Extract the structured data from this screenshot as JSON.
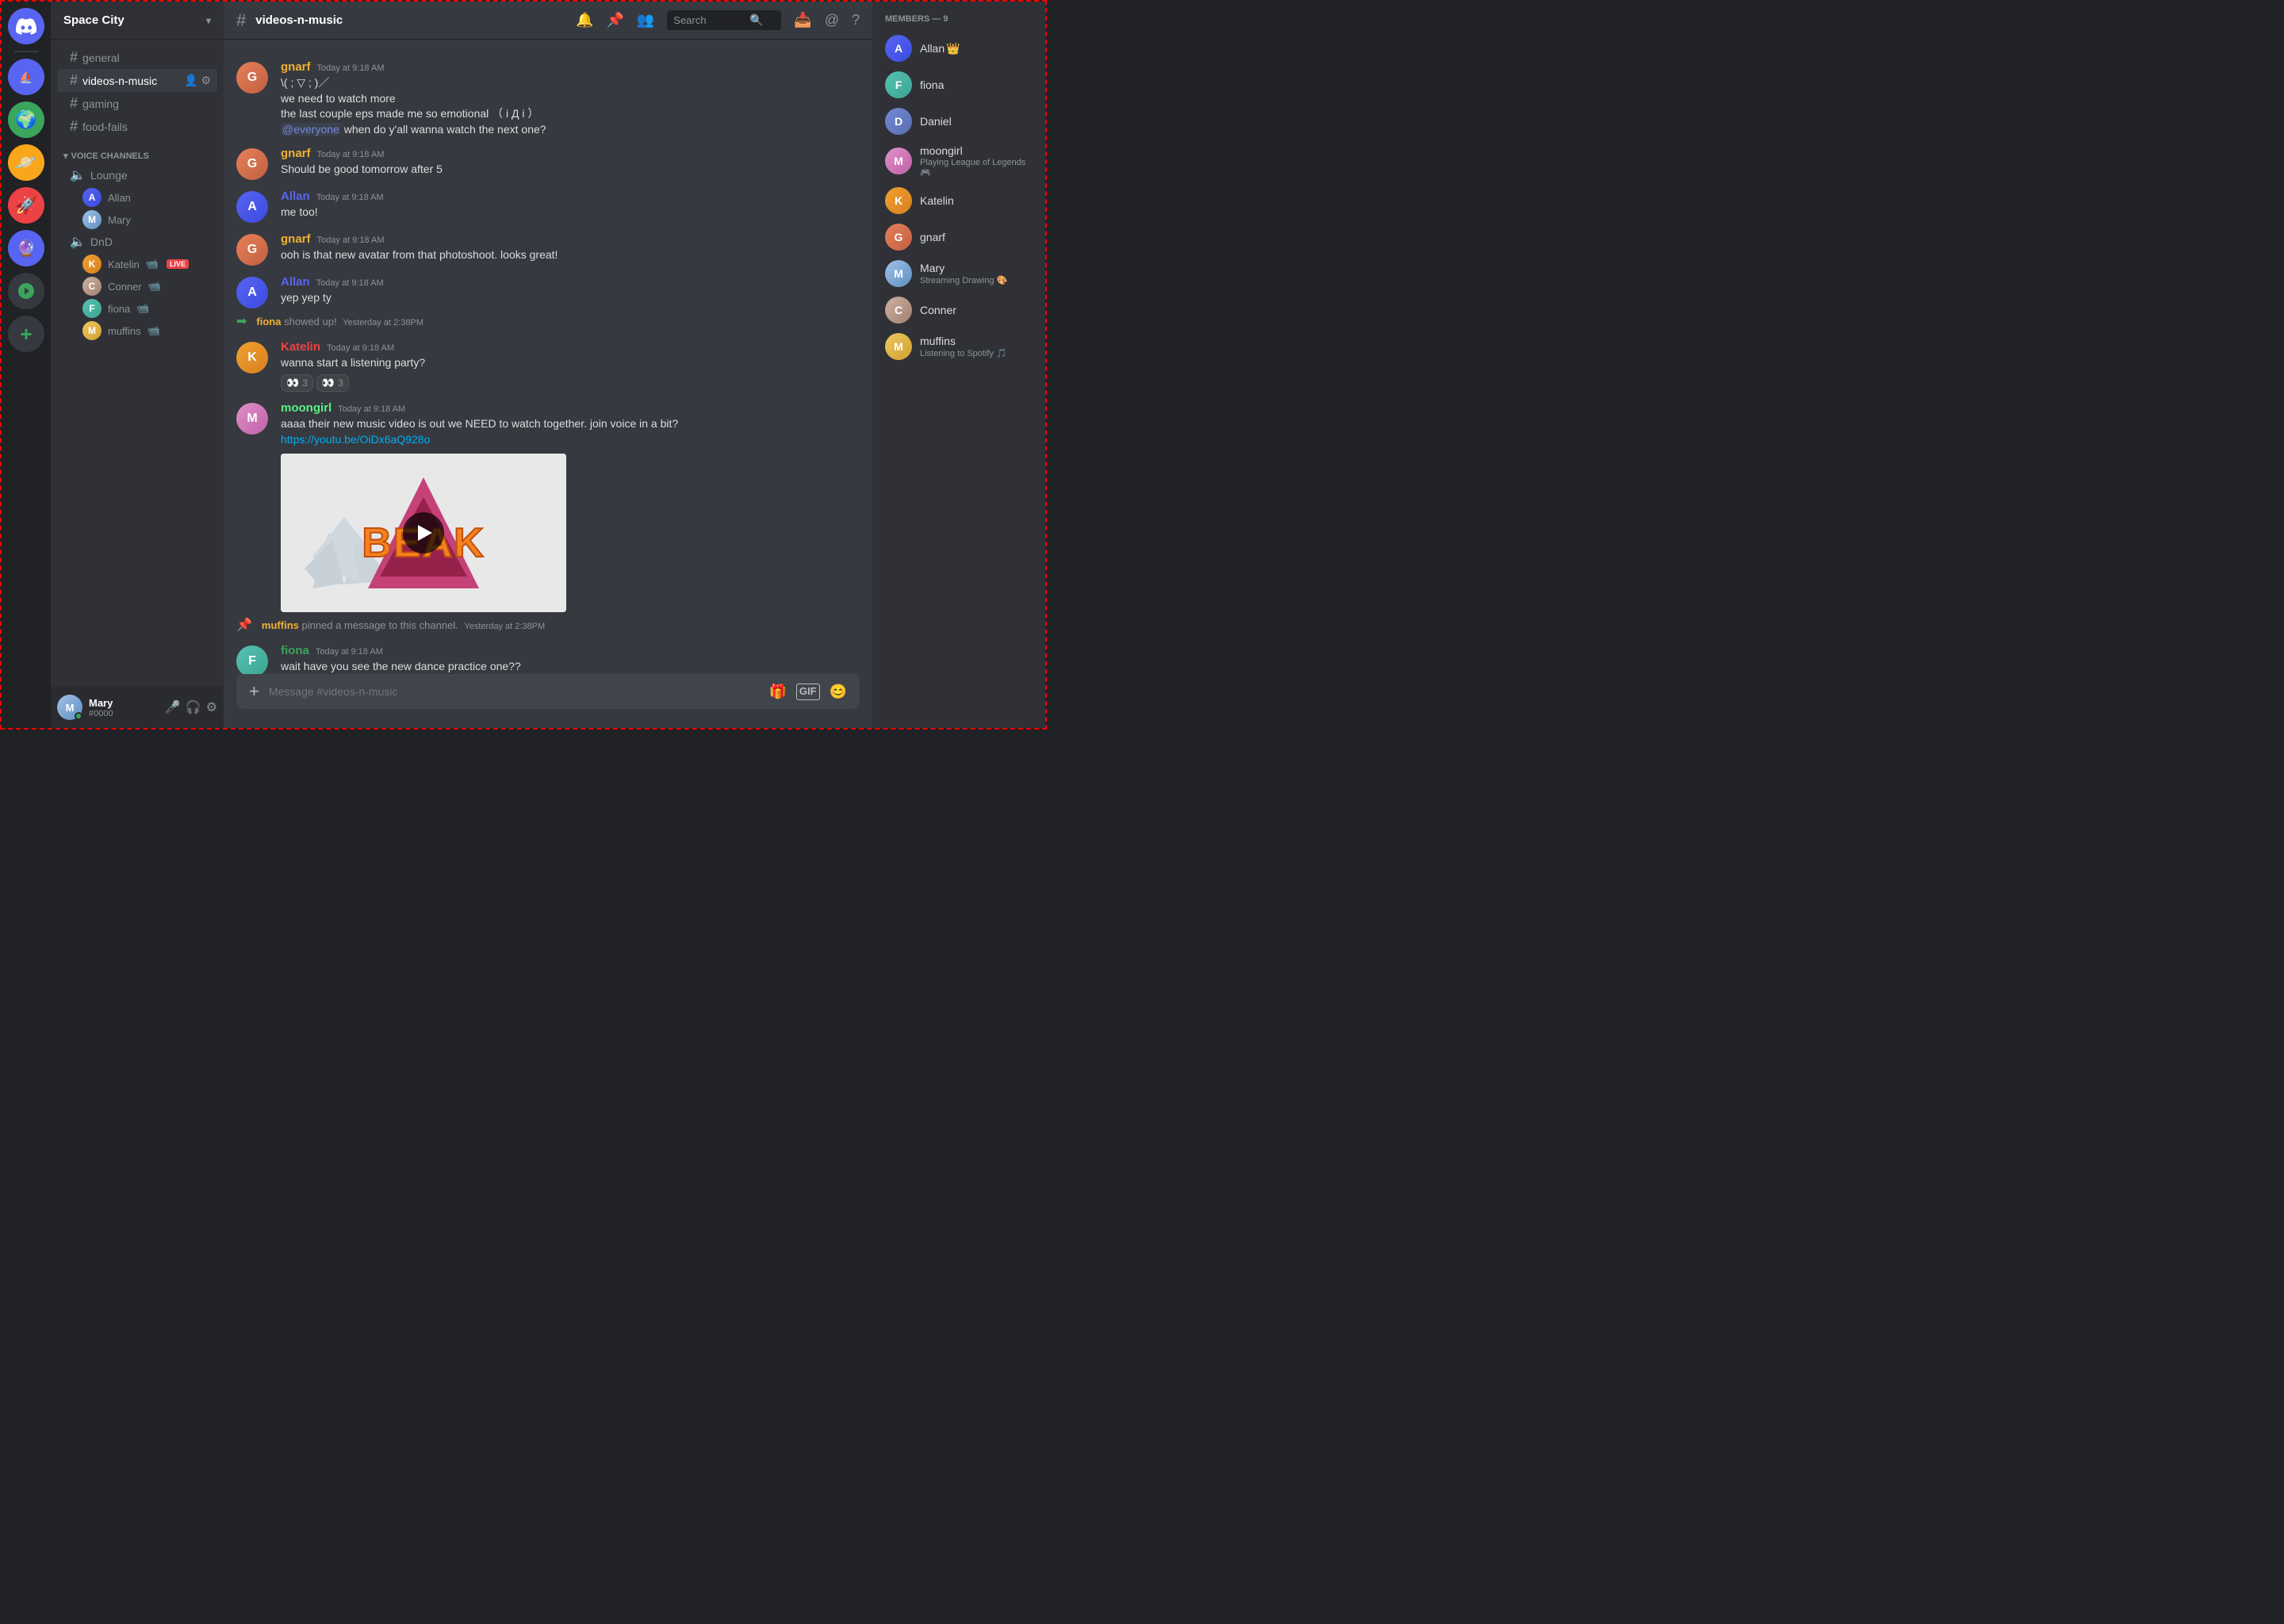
{
  "app": {
    "title": "DISCORD"
  },
  "server": {
    "name": "Space City",
    "channel_active": "videos-n-music"
  },
  "channels": {
    "text": [
      {
        "name": "general",
        "hash": "#"
      },
      {
        "name": "videos-n-music",
        "hash": "#",
        "active": true
      },
      {
        "name": "gaming",
        "hash": "#"
      },
      {
        "name": "food-fails",
        "hash": "#"
      }
    ],
    "voice_category": "VOICE CHANNELS",
    "lounge": {
      "name": "Lounge",
      "users": [
        "Allan",
        "Mary"
      ]
    },
    "dnd": {
      "name": "DnD",
      "users": [
        "Katelin",
        "Conner",
        "fiona",
        "muffins"
      ]
    }
  },
  "messages": [
    {
      "id": "m1",
      "author": "gnarf",
      "author_class": "gnarf",
      "timestamp": "Today at 9:18 AM",
      "lines": [
        "\\( ; ▽ ; )／",
        "we need to watch more",
        "the last couple eps made me so emotional （ i Д i ）",
        "@everyone when do y'all wanna watch the next one?"
      ]
    },
    {
      "id": "m2",
      "author": "gnarf",
      "author_class": "gnarf",
      "timestamp": "Today at 9:18 AM",
      "lines": [
        "Should be good tomorrow after 5"
      ]
    },
    {
      "id": "m3",
      "author": "Allan",
      "author_class": "allan",
      "timestamp": "Today at 9:18 AM",
      "lines": [
        "me too!"
      ]
    },
    {
      "id": "m4",
      "author": "gnarf",
      "author_class": "gnarf",
      "timestamp": "Today at 9:18 AM",
      "lines": [
        "ooh is that new avatar from that photoshoot. looks great!"
      ]
    },
    {
      "id": "m5",
      "author": "Allan",
      "author_class": "allan",
      "timestamp": "Today at 9:18 AM",
      "lines": [
        "yep yep ty"
      ]
    },
    {
      "id": "m6_system",
      "type": "system",
      "user": "fiona",
      "action": "showed up!",
      "timestamp": "Yesterday at 2:38PM"
    },
    {
      "id": "m7",
      "author": "Katelin",
      "author_class": "katelin",
      "timestamp": "Today at 9:18 AM",
      "lines": [
        "wanna start a listening party?"
      ],
      "reactions": [
        {
          "emoji": "👀",
          "count": 3
        },
        {
          "emoji": "👀",
          "count": 3
        }
      ]
    },
    {
      "id": "m8",
      "author": "moongirl",
      "author_class": "moongirl",
      "timestamp": "Today at 9:18 AM",
      "lines": [
        "aaaa their new music video is out we NEED to watch together. join voice in a bit?",
        "https://youtu.be/OiDx6aQ928o"
      ],
      "has_video": true,
      "video_url": "https://youtu.be/OiDx6aQ928o"
    },
    {
      "id": "m9_system",
      "type": "system_pin",
      "user": "muffins",
      "action": "pinned a message to this channel.",
      "timestamp": "Yesterday at 2:38PM"
    },
    {
      "id": "m10",
      "author": "fiona",
      "author_class": "fiona",
      "timestamp": "Today at 9:18 AM",
      "lines": [
        "wait have you see the new dance practice one??"
      ]
    }
  ],
  "chat_input": {
    "placeholder": "Message #videos-n-music"
  },
  "members": {
    "header": "MEMBERS — 9",
    "list": [
      {
        "name": "Allan",
        "av_class": "av-allan",
        "initial": "A",
        "badge": "👑",
        "status": null
      },
      {
        "name": "fiona",
        "av_class": "av-fiona",
        "initial": "F",
        "status": null
      },
      {
        "name": "Daniel",
        "av_class": "av-daniel",
        "initial": "D",
        "status": null
      },
      {
        "name": "moongirl",
        "av_class": "av-moongirl",
        "initial": "M",
        "status": "Playing League of Legends"
      },
      {
        "name": "Katelin",
        "av_class": "av-katelin",
        "initial": "K",
        "status": null
      },
      {
        "name": "gnarf",
        "av_class": "av-gnarf",
        "initial": "G",
        "status": null
      },
      {
        "name": "Mary",
        "av_class": "av-mary",
        "initial": "M",
        "status": "Streaming Drawing 🎨"
      },
      {
        "name": "Conner",
        "av_class": "av-conner",
        "initial": "C",
        "status": null
      },
      {
        "name": "muffins",
        "av_class": "av-muffins",
        "initial": "M",
        "status": "Listening to Spotify 🎵"
      }
    ]
  },
  "current_user": {
    "name": "Mary",
    "discriminator": "#0000",
    "av_class": "av-mary"
  },
  "header": {
    "channel": "videos-n-music",
    "search_placeholder": "Search"
  },
  "icons": {
    "bell": "🔔",
    "pin": "📌",
    "members": "👥",
    "search": "🔍",
    "inbox": "📥",
    "mention": "@",
    "help": "?",
    "mic": "🎤",
    "headphones": "🎧",
    "settings": "⚙"
  }
}
